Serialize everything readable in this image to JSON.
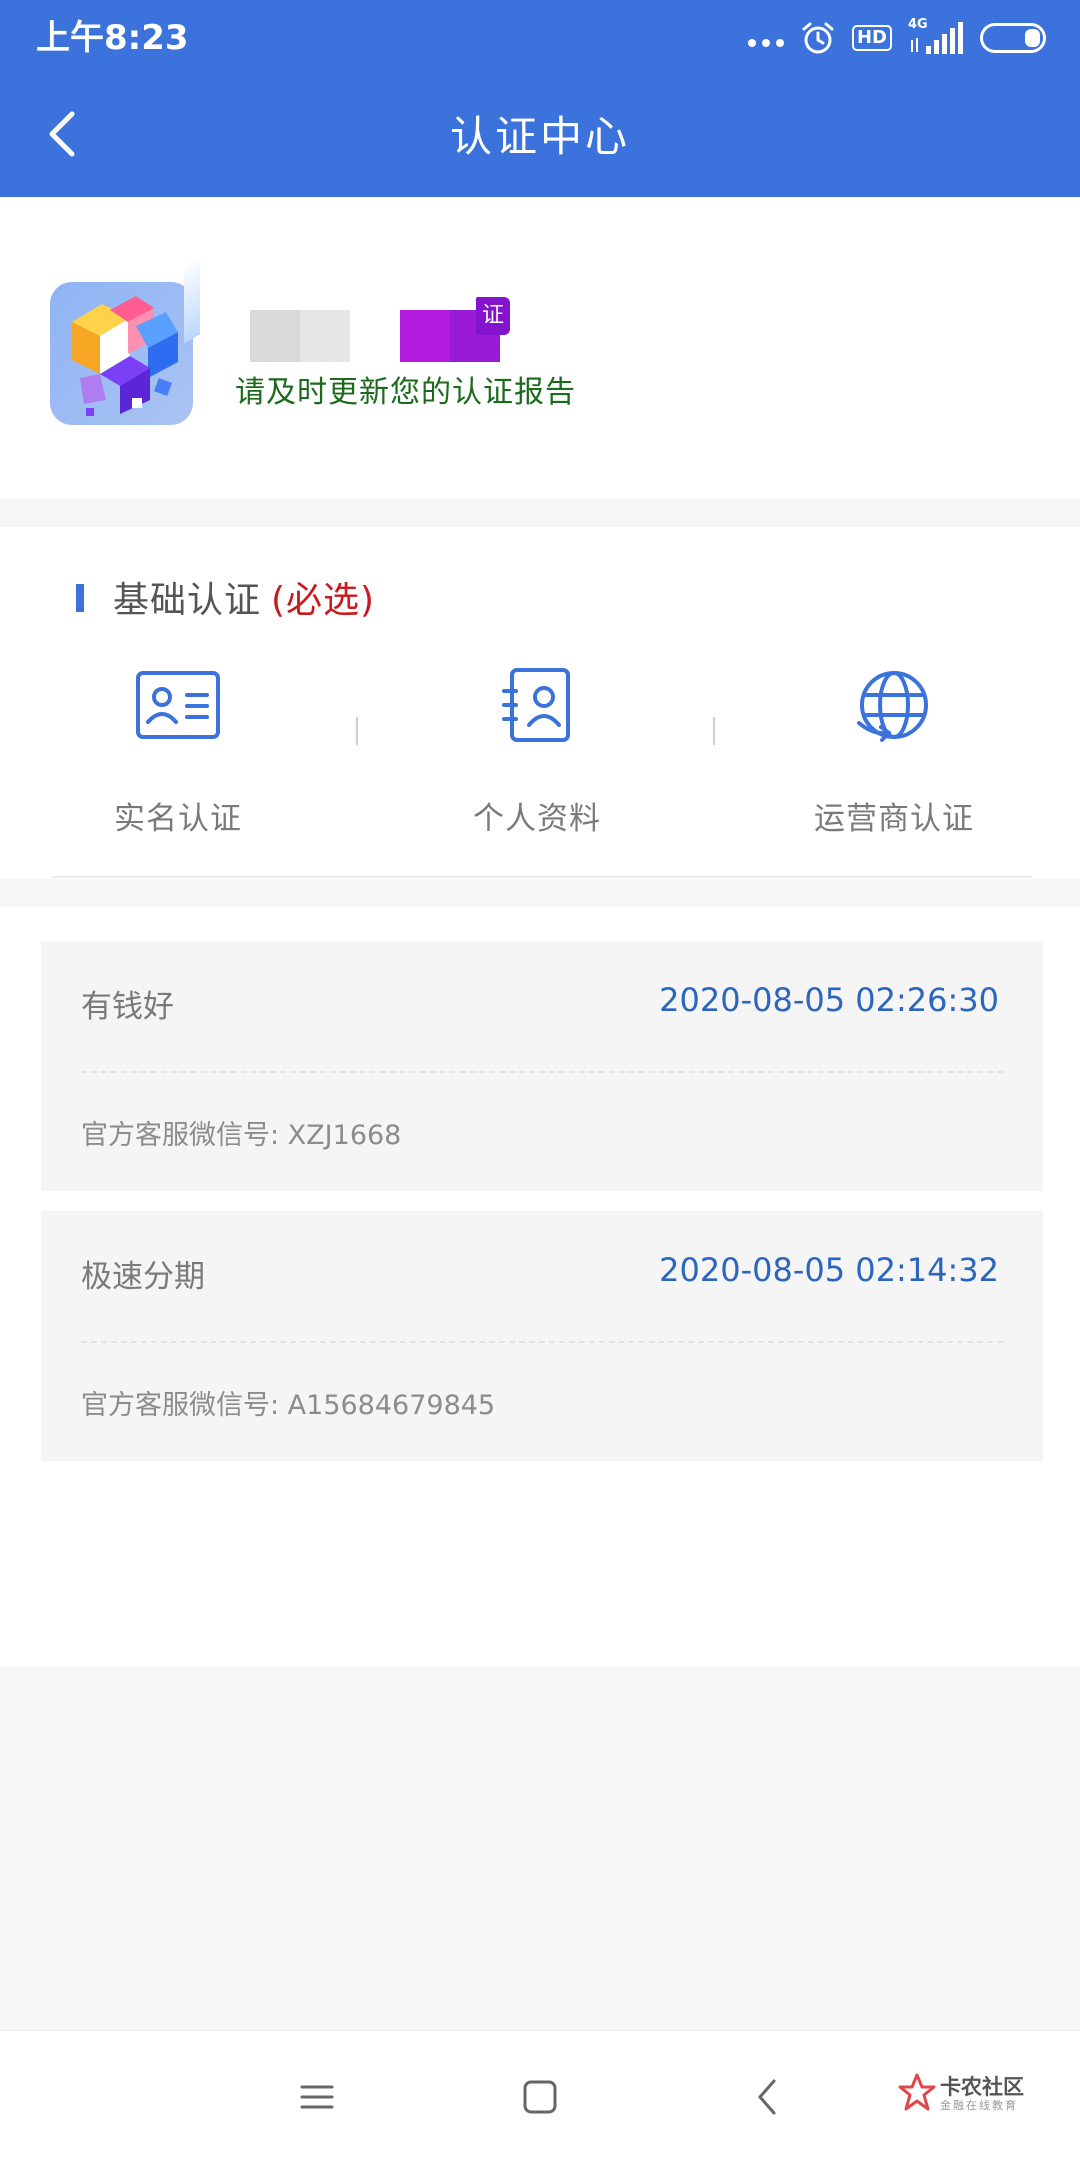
{
  "status_bar": {
    "time": "上午8:23",
    "network": "4G",
    "hd": "HD"
  },
  "nav": {
    "title": "认证中心"
  },
  "profile": {
    "badge": "证",
    "subtitle": "请及时更新您的认证报告"
  },
  "basic_section": {
    "title": "基础认证",
    "required": "(必选)",
    "items": [
      {
        "label": "实名认证",
        "icon": "id-card-icon"
      },
      {
        "label": "个人资料",
        "icon": "profile-document-icon"
      },
      {
        "label": "运营商认证",
        "icon": "globe-operator-icon"
      }
    ]
  },
  "records": [
    {
      "name": "有钱好",
      "time": "2020-08-05 02:26:30",
      "wechat": "官方客服微信号: XZJ1668"
    },
    {
      "name": "极速分期",
      "time": "2020-08-05 02:14:32",
      "wechat": "官方客服微信号: A15684679845"
    }
  ],
  "system_nav": {
    "watermark_title": "卡农社区",
    "watermark_sub": "金融在线教育"
  },
  "colors": {
    "primary": "#3b72db",
    "required_red": "#c8191c",
    "subtitle_green": "#1c6b1c",
    "time_blue": "#2c65bd",
    "badge_purple": "#8413ce"
  }
}
